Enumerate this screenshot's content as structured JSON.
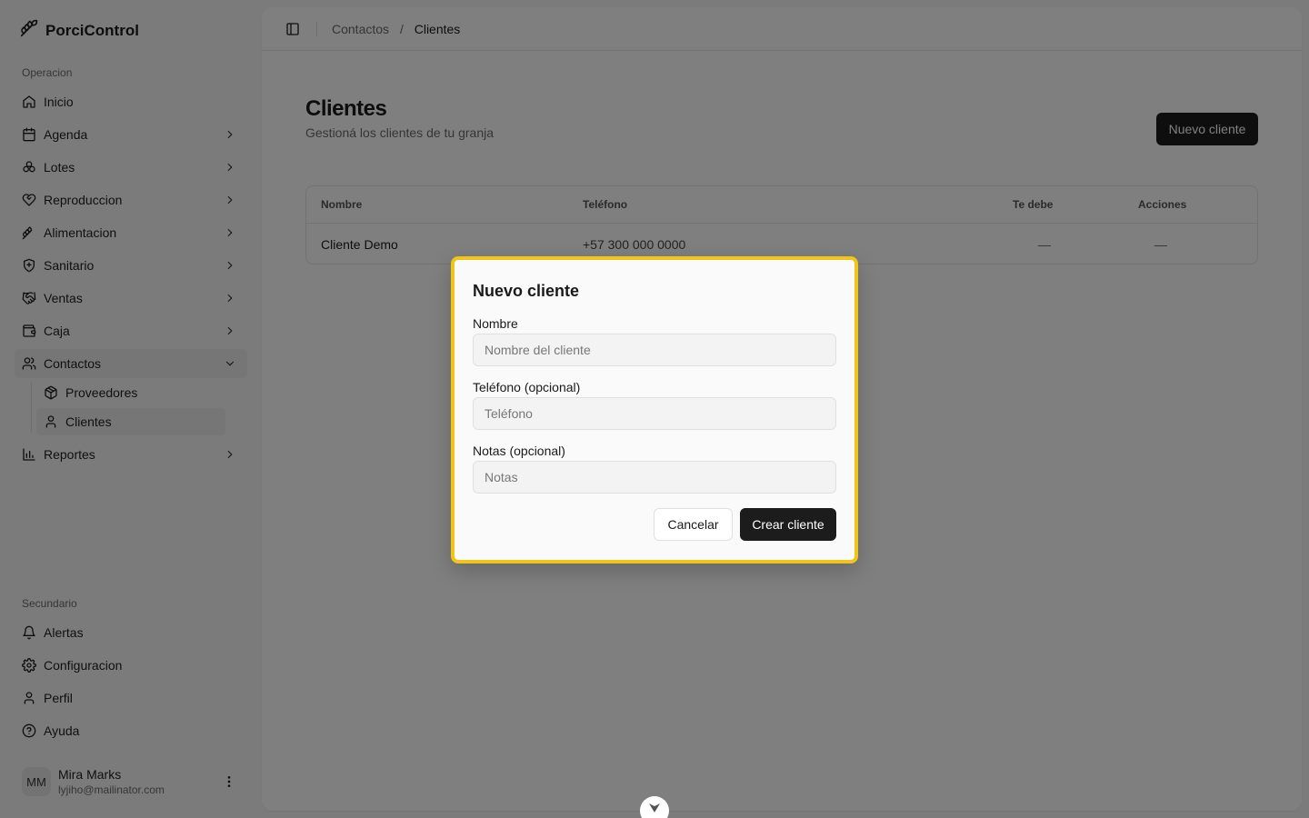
{
  "brand": {
    "name": "PorciControl"
  },
  "sidebar": {
    "section_primary": "Operacion",
    "items": [
      {
        "label": "Inicio",
        "icon": "home-icon"
      },
      {
        "label": "Agenda",
        "icon": "calendar-icon"
      },
      {
        "label": "Lotes",
        "icon": "lots-icon"
      },
      {
        "label": "Reproduccion",
        "icon": "heart-icon"
      },
      {
        "label": "Alimentacion",
        "icon": "feed-icon"
      },
      {
        "label": "Sanitario",
        "icon": "shield-icon"
      },
      {
        "label": "Ventas",
        "icon": "handshake-icon"
      },
      {
        "label": "Caja",
        "icon": "wallet-icon"
      },
      {
        "label": "Contactos",
        "icon": "users-icon"
      },
      {
        "label": "Reportes",
        "icon": "bar-chart-icon"
      }
    ],
    "contactos_sub": [
      {
        "label": "Proveedores",
        "icon": "package-icon"
      },
      {
        "label": "Clientes",
        "icon": "user-icon"
      }
    ],
    "section_secondary": "Secundario",
    "secondary_items": [
      {
        "label": "Alertas",
        "icon": "bell-icon"
      },
      {
        "label": "Configuracion",
        "icon": "gear-icon"
      },
      {
        "label": "Perfil",
        "icon": "user-icon"
      },
      {
        "label": "Ayuda",
        "icon": "help-icon"
      }
    ],
    "user": {
      "initials": "MM",
      "name": "Mira Marks",
      "email": "lyjiho@mailinator.com"
    }
  },
  "breadcrumb": {
    "parent": "Contactos",
    "separator": "/",
    "current": "Clientes"
  },
  "page": {
    "title": "Clientes",
    "subtitle": "Gestioná los clientes de tu granja",
    "new_button": "Nuevo cliente"
  },
  "table": {
    "headers": [
      "Nombre",
      "Teléfono",
      "Te debe",
      "Acciones"
    ],
    "rows": [
      {
        "nombre": "Cliente Demo",
        "telefono": "+57 300 000 0000",
        "te_debe": "—",
        "acciones": "—"
      }
    ]
  },
  "dialog": {
    "title": "Nuevo cliente",
    "fields": [
      {
        "label": "Nombre",
        "placeholder": "Nombre del cliente",
        "value": ""
      },
      {
        "label": "Teléfono (opcional)",
        "placeholder": "Teléfono",
        "value": ""
      },
      {
        "label": "Notas (opcional)",
        "placeholder": "Notas",
        "value": ""
      }
    ],
    "cancel_label": "Cancelar",
    "submit_label": "Crear cliente"
  },
  "colors": {
    "accent": "#1c1c1c",
    "highlight_border": "#f0c419",
    "overlay": "rgba(0,0,0,0.5)"
  }
}
